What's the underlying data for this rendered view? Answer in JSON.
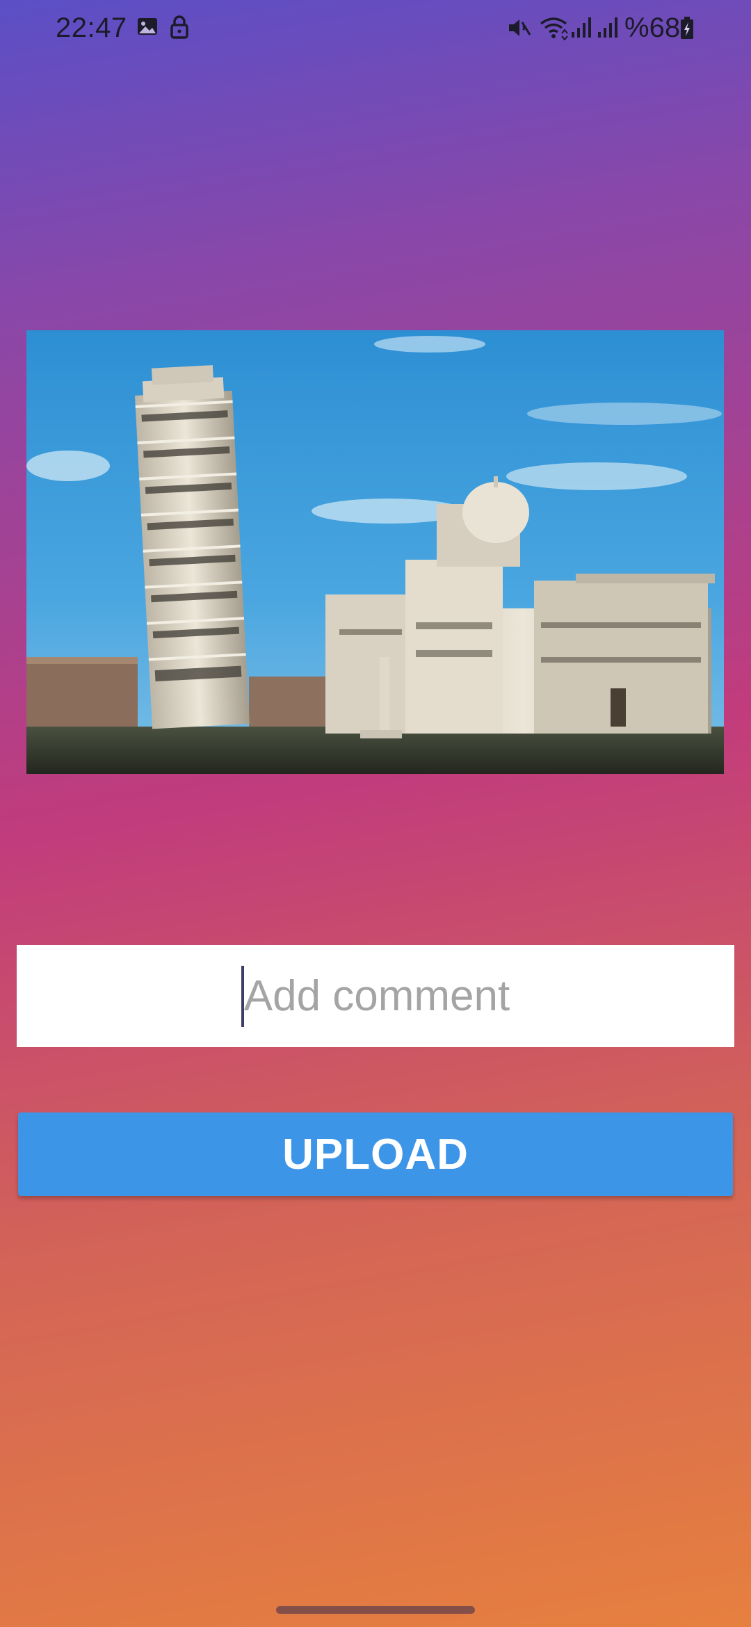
{
  "status_bar": {
    "time": "22:47",
    "battery_text": "%68",
    "icons": [
      "gallery-icon",
      "lock-icon",
      "mute-icon",
      "wifi-icon",
      "signal-icon",
      "signal-icon-2",
      "battery-charging-icon"
    ]
  },
  "comment": {
    "placeholder": "Add comment"
  },
  "upload": {
    "label": "UPLOAD"
  },
  "colors": {
    "gradient_top": "#5b4fc6",
    "gradient_middle": "#c13c7c",
    "gradient_bottom": "#e6803f",
    "button": "#3d95e8"
  }
}
